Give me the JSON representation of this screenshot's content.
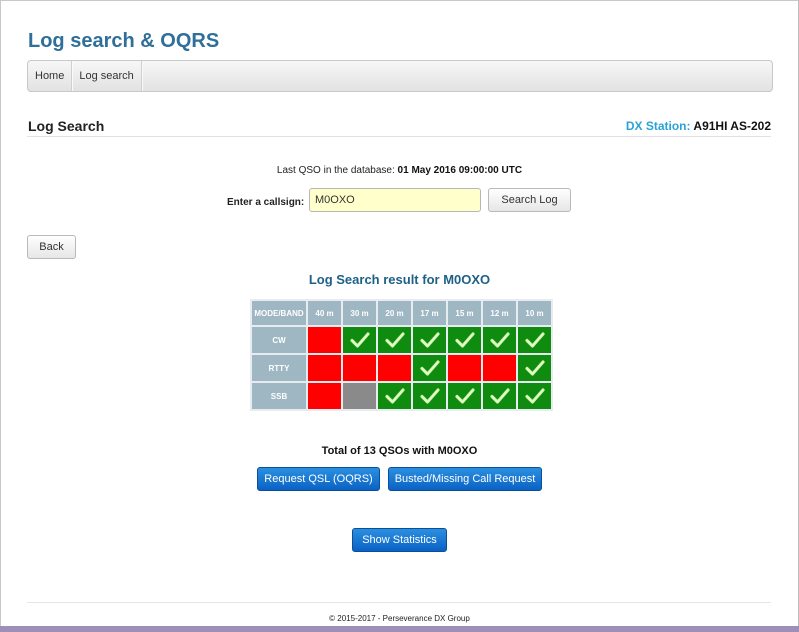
{
  "site": {
    "title": "Log search & OQRS"
  },
  "nav": [
    {
      "label": "Home"
    },
    {
      "label": "Log search"
    }
  ],
  "section": {
    "title": "Log Search",
    "dx_station_label": "DX Station:",
    "dx_station_value": "A91HI AS-202"
  },
  "last_qso": {
    "prefix": "Last QSO in the database:",
    "value": "01 May 2016 09:00:00 UTC"
  },
  "search": {
    "label": "Enter a callsign:",
    "value": "M0OXO",
    "button": "Search Log"
  },
  "back_button": "Back",
  "result": {
    "title": "Log Search result for M0OXO",
    "corner": "MODE/BAND",
    "bands": [
      "40 m",
      "30 m",
      "20 m",
      "17 m",
      "15 m",
      "12 m",
      "10 m"
    ],
    "rows": [
      {
        "mode": "CW",
        "cells": [
          "red",
          "green",
          "green",
          "green",
          "green",
          "green",
          "green"
        ]
      },
      {
        "mode": "RTTY",
        "cells": [
          "red",
          "red",
          "red",
          "green",
          "red",
          "red",
          "green"
        ]
      },
      {
        "mode": "SSB",
        "cells": [
          "red",
          "grey",
          "green",
          "green",
          "green",
          "green",
          "green"
        ]
      }
    ],
    "colors": {
      "red": "#ff0000",
      "green": "#0f8c0f",
      "grey": "#8a8a8a",
      "header": "#9fb6c3"
    },
    "total": "Total of 13 QSOs with M0OXO"
  },
  "actions": {
    "request_qsl": "Request QSL (OQRS)",
    "busted": "Busted/Missing Call Request",
    "statistics": "Show Statistics"
  },
  "footer": "© 2015-2017 - Perseverance DX Group"
}
